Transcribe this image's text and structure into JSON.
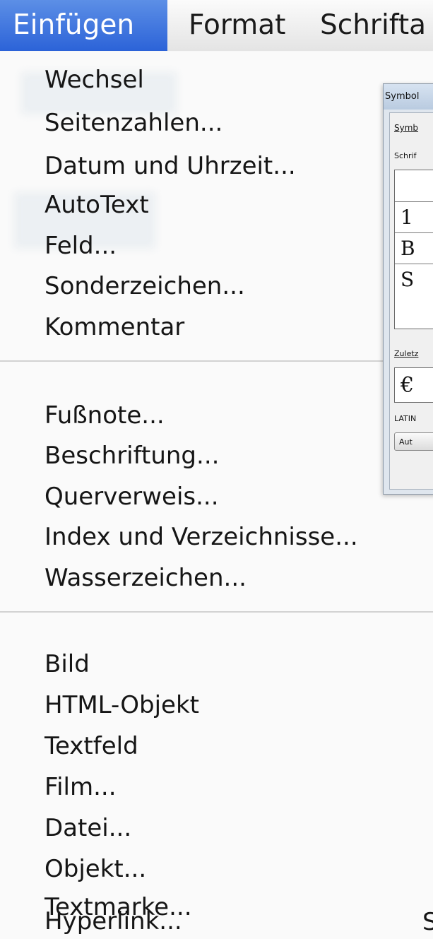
{
  "menubar": {
    "items": [
      "Einfügen",
      "Format",
      "Schrifta"
    ],
    "active_color": "#2c63d8"
  },
  "menu": {
    "group1": [
      "Wechsel",
      "Seitenzahlen...",
      "Datum und Uhrzeit...",
      "AutoText",
      "Feld...",
      "Sonderzeichen...",
      "Kommentar"
    ],
    "group2": [
      "Fußnote...",
      "Beschriftung...",
      "Querverweis...",
      "Index und Verzeichnisse...",
      "Wasserzeichen..."
    ],
    "group3": [
      "Bild",
      "HTML-Objekt",
      "Textfeld",
      "Film...",
      "Datei...",
      "Objekt...",
      "Textmarke...",
      "Hyperlink..."
    ],
    "hyperlink_shortcut": "S"
  },
  "dialog": {
    "title": "Symbol",
    "tab": "Symb",
    "font_label": "Schrif",
    "grid_cells": [
      "",
      "1",
      "B",
      "S"
    ],
    "recent_label": "Zuletz",
    "recent_symbol": "€",
    "char_name": "LATIN",
    "autocorrect_button": "Aut"
  }
}
